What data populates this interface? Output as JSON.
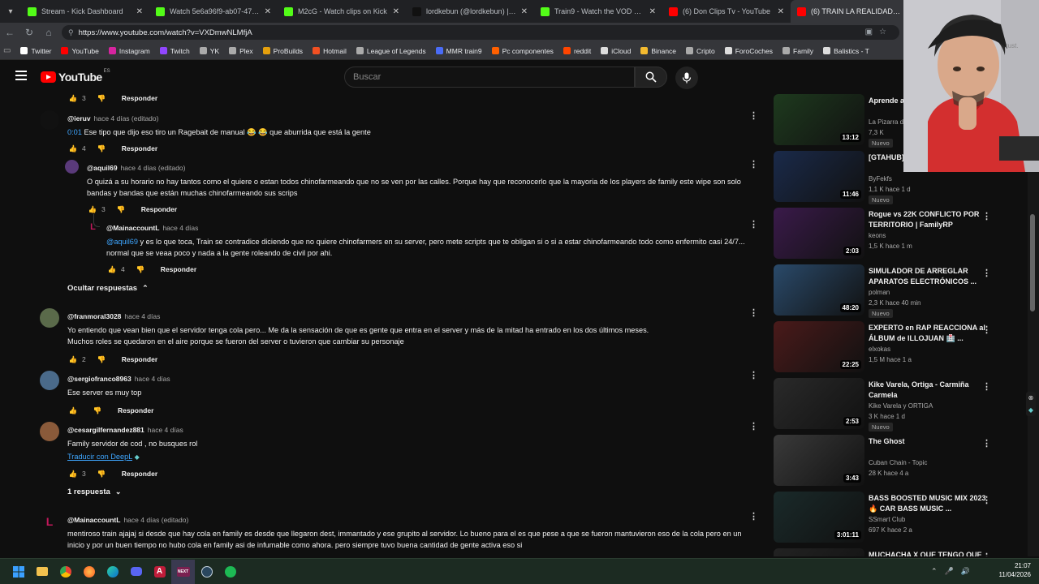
{
  "browser": {
    "tabs": [
      {
        "title": "Stream - Kick Dashboard",
        "color": "#53fc18",
        "active": false
      },
      {
        "title": "Watch 5e6a96f9-ab07-47b6-84a7",
        "color": "#53fc18",
        "active": false
      },
      {
        "title": "M2cG - Watch clips on Kick",
        "color": "#53fc18",
        "active": false
      },
      {
        "title": "lordkebun (@lordkebun) | TikTok",
        "color": "#111111",
        "active": false
      },
      {
        "title": "Train9 - Watch the VOD on Kick",
        "color": "#53fc18",
        "active": false
      },
      {
        "title": "(6) Don Clips Tv - YouTube",
        "color": "#ff0000",
        "active": false
      },
      {
        "title": "(6) TRAIN LA REALIDAD de FAMI",
        "color": "#ff0000",
        "active": true
      }
    ],
    "url": "https://www.youtube.com/watch?v=VXDmwNLMfjA",
    "bookmarks": [
      {
        "label": "Twitter",
        "color": "#ffffff"
      },
      {
        "label": "YouTube",
        "color": "#ff0000"
      },
      {
        "label": "Instagram",
        "color": "#d6249f"
      },
      {
        "label": "Twitch",
        "color": "#9146ff"
      },
      {
        "label": "YK",
        "color": "#aaaaaa"
      },
      {
        "label": "Plex",
        "color": "#aaaaaa"
      },
      {
        "label": "ProBuilds",
        "color": "#e5a00d"
      },
      {
        "label": "Hotmail",
        "color": "#f25022"
      },
      {
        "label": "League of Legends",
        "color": "#aaaaaa"
      },
      {
        "label": "MMR train9",
        "color": "#4a6cf7"
      },
      {
        "label": "Pc componentes",
        "color": "#ff6000"
      },
      {
        "label": "reddit",
        "color": "#ff4500"
      },
      {
        "label": "iCloud",
        "color": "#dddddd"
      },
      {
        "label": "Binance",
        "color": "#f3ba2f"
      },
      {
        "label": "Cripto",
        "color": "#aaaaaa"
      },
      {
        "label": "ForoCoches",
        "color": "#dddddd"
      },
      {
        "label": "Family",
        "color": "#aaaaaa"
      },
      {
        "label": "Balistics - T",
        "color": "#dddddd"
      }
    ]
  },
  "youtube": {
    "logo_text": "YouTube",
    "country": "ES",
    "search_placeholder": "Buscar",
    "reply_label": "Responder"
  },
  "comments": [
    {
      "handle": "@ieruv",
      "meta": "hace 4 días (editado)",
      "timestamp": "0:01",
      "text": "Ese tipo que dijo eso tiro un Ragebait de manual 😂 😂 que aburrida que está la gente",
      "likes": "4",
      "avatar": "#111111"
    },
    {
      "handle": "@aquil69",
      "meta": "hace 4 días (editado)",
      "text": "O quizá a su horario no hay tantos como el quiere o estan todos chinofarmeando que no se ven por las calles. Porque hay que reconocerlo que la mayoria de los players de family este wipe son solo bandas y bandas que están muchas chinofarmeando sus scrips",
      "likes": "3",
      "avatar": "#5a3a7a"
    },
    {
      "handle": "@MainaccountL",
      "meta": "hace 4 días",
      "mention": "@aquil69",
      "text": " y es lo que toca, Train se contradice diciendo que no quiere chinofarmers en su server, pero mete scripts que te obligan si o si a estar chinofarmeando todo como enfermito casi 24/7... normal que se veaa poco y nada a la gente roleando de civil por ahi.",
      "likes": "4",
      "avatar": "#c2185b"
    },
    {
      "handle": "@franmoral3028",
      "meta": "hace 4 días",
      "text": "Yo entiendo que vean bien que el servidor tenga cola pero... Me da la sensación de que es gente que entra en el server y más de la mitad ha entrado en los dos últimos meses.",
      "text2": "Muchos roles se quedaron en el aire porque se fueron del server o tuvieron que cambiar su personaje",
      "likes": "2",
      "avatar": "#5a6a4a"
    },
    {
      "handle": "@sergiofranco8963",
      "meta": "hace 4 días",
      "text": "Ese server es muy top",
      "likes": "",
      "avatar": "#4a6a8a"
    },
    {
      "handle": "@cesargilfernandez881",
      "meta": "hace 4 días",
      "text": "Family servidor de cod , no busques rol",
      "translate": "Traducir con DeepL",
      "likes": "3",
      "avatar": "#8a5a3a"
    },
    {
      "handle": "@MainaccountL",
      "meta": "hace 4 días (editado)",
      "text": "mentiroso train ajajaj si desde que hay cola en family es desde que llegaron dest, immantado y ese grupito al servidor. Lo bueno para el es que pese a que se fueron mantuvieron eso de la cola pero en un inicio y por un buen tiempo no hubo cola en family asi de infumable como ahora. pero siempre tuvo buena cantidad de gente activa eso si",
      "likes": "",
      "avatar": "#c2185b"
    }
  ],
  "thread_toggles": {
    "hide": "Ocultar respuestas",
    "show": "1 respuesta"
  },
  "recommendations": [
    {
      "title": "Aprende a y DETECTA",
      "channel": "La Pizarra de",
      "stats": "7,3 K",
      "new": "Nuevo",
      "duration": "13:12",
      "thumb": "#1e3a1e"
    },
    {
      "title": "[GTAHUB] JASJDSAJ",
      "channel": "ByFekfs",
      "stats": "1,1 K  hace 1 d",
      "new": "Nuevo",
      "duration": "11:46",
      "thumb": "#1a2a4a"
    },
    {
      "title": "Rogue vs 22K CONFLICTO POR TERRITORIO | FamilyRP",
      "channel": "keons",
      "stats": "1,5 K  hace 1 m",
      "new": "",
      "duration": "2:03",
      "thumb": "#3a1a4a"
    },
    {
      "title": "SIMULADOR DE ARREGLAR APARATOS ELECTRÓNICOS ...",
      "channel": "polman",
      "stats": "2,3 K  hace 40 min",
      "new": "Nuevo",
      "duration": "48:20",
      "thumb": "#2a4a6a"
    },
    {
      "title": "EXPERTO en RAP REACCIONA al ÁLBUM de ILLOJUAN 🏥 ...",
      "channel": "elxokas",
      "stats": "1,5 M  hace 1 a",
      "new": "",
      "duration": "22:25",
      "thumb": "#4a1a1a"
    },
    {
      "title": "Kike Varela, Ortiga - Carmiña Carmela",
      "channel": "Kike Varela  y ORTIGA",
      "stats": "3 K  hace 1 d",
      "new": "Nuevo",
      "duration": "2:53",
      "thumb": "#2a2a2a"
    },
    {
      "title": "The Ghost",
      "channel": "Cuban Chain - Topic",
      "stats": "28 K  hace 4 a",
      "new": "",
      "duration": "3:43",
      "thumb": "#3a3a3a"
    },
    {
      "title": "BASS BOOSTED MUSIC MIX 2023 🔥 CAR BASS MUSIC ...",
      "channel": "SSmart Club",
      "stats": "697 K  hace 2 a",
      "new": "",
      "duration": "3:01:11",
      "thumb": "#1a2a2a"
    },
    {
      "title": "MUCHACHA X QUE TENGO QUE",
      "channel": "",
      "stats": "",
      "new": "",
      "duration": "",
      "thumb": "#222222"
    }
  ],
  "taskbar": {
    "time": "21:07",
    "date": "11/04/2026"
  }
}
